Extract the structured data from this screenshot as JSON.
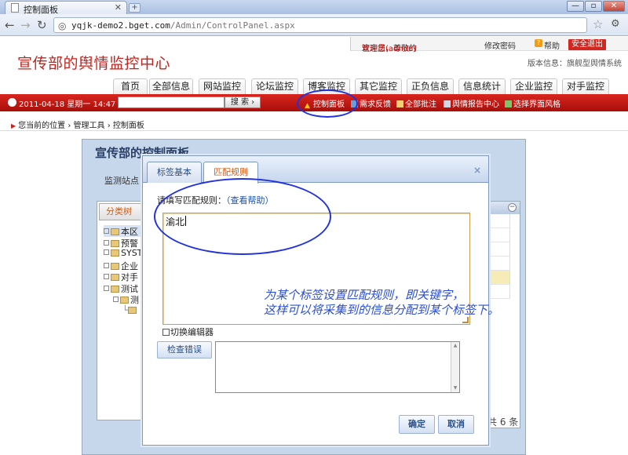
{
  "browser": {
    "tab_title": "控制面板",
    "tab_close": "✕",
    "new_tab": "+",
    "url_host": "yqjk-demo2.bget.com",
    "url_path": "/Admin/ControlPanel.aspx",
    "win_min": "—",
    "win_max": "▫",
    "win_close": "✕"
  },
  "userbar": {
    "welcome_prefix": "欢迎您，尊敬的",
    "user": "管理员(admin)",
    "change_password": "修改密码",
    "help_icon": "?",
    "help": "帮助",
    "logout": "安全退出"
  },
  "site": {
    "title": "宣传部的舆情监控中心",
    "version": "版本信息：旗舰型舆情系统"
  },
  "menu": [
    "首页",
    "全部信息",
    "网站监控",
    "论坛监控",
    "博客监控",
    "其它监控",
    "正负信息",
    "信息统计",
    "企业监控",
    "对手监控"
  ],
  "toolbar": {
    "date": "2011-04-18 星期一 14:47",
    "search_btn": "搜 索 ›",
    "links": [
      "控制面板",
      "需求反馈",
      "全部批注",
      "舆情报告中心",
      "选择界面风格"
    ]
  },
  "breadcrumb": "您当前的位置 › 管理工具 › 控制面板",
  "panel": {
    "title": "宣传部的控制面板",
    "station_label": "监测站点",
    "tree_tab": "分类树",
    "tree": [
      "本区",
      "预警",
      "SYST",
      "企业",
      "对手",
      "测试",
      "测",
      ""
    ],
    "count": "共 6 条"
  },
  "dialog": {
    "tabs": [
      "标签基本",
      "匹配规则"
    ],
    "close": "×",
    "prompt": "请填写匹配规则：",
    "help_link": "（查看帮助）",
    "rules_value": "渝北",
    "note_line1": "为某个标签设置匹配规则，即关键字，",
    "note_line2": "这样可以将采集到的信息分配到某个标签下。",
    "toggle_editor": "切换编辑器",
    "check_errors": "检查错误",
    "ok": "确定",
    "cancel": "取消"
  },
  "colors": {
    "brand_red": "#c8211b",
    "annotation_blue": "#2233dd"
  }
}
